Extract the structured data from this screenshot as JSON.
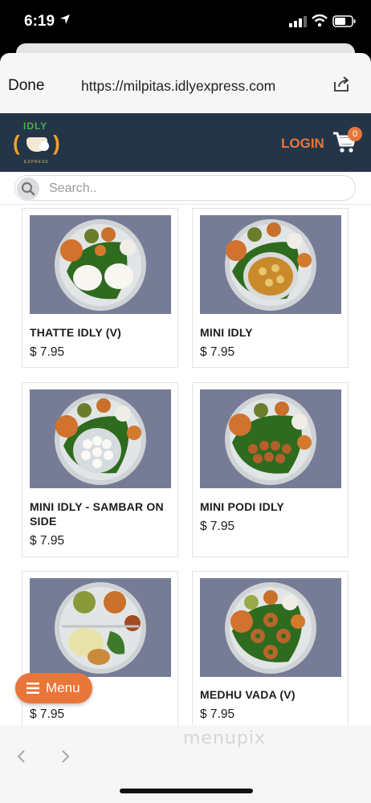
{
  "status_bar": {
    "time": "6:19"
  },
  "browser": {
    "done_label": "Done",
    "url": "https://milpitas.idlyexpress.com"
  },
  "site_header": {
    "logo_text": "IDLY",
    "logo_subtext": "EXPRESS",
    "login_label": "LOGIN",
    "cart_count": "0",
    "brand_color": "#243548",
    "accent_color": "#e8763a"
  },
  "search": {
    "placeholder": "Search.."
  },
  "products": [
    {
      "name": "THATTE IDLY (V)",
      "price": "$ 7.95"
    },
    {
      "name": "MINI IDLY",
      "price": "$ 7.95"
    },
    {
      "name": "MINI IDLY - SAMBAR ON SIDE",
      "price": "$ 7.95"
    },
    {
      "name": "MINI PODI IDLY",
      "price": "$ 7.95"
    },
    {
      "name": "",
      "price": "$ 7.95"
    },
    {
      "name": "MEDHU VADA (V)",
      "price": "$ 7.95"
    }
  ],
  "menu_button": {
    "label": "Menu"
  },
  "watermark": "menupix"
}
